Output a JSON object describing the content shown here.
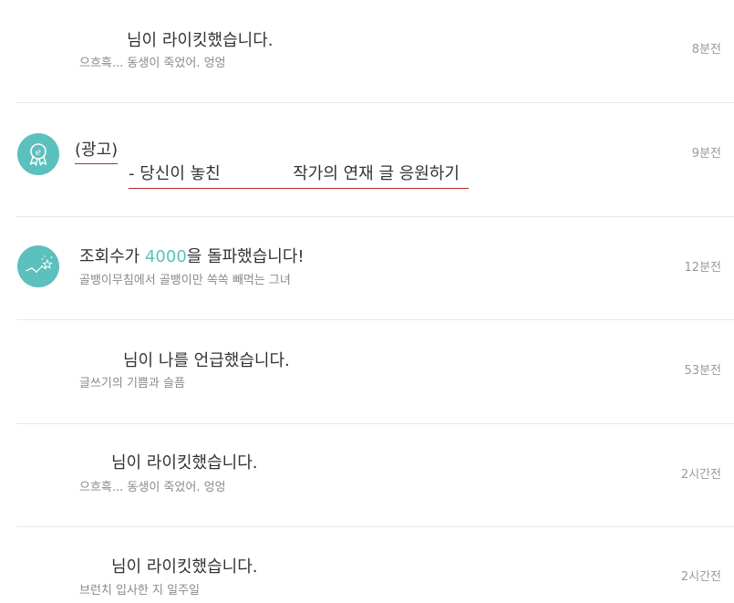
{
  "notifications": [
    {
      "title": "님이 라이킷했습니다.",
      "subtitle": "으흐흑... 동생이 죽었어. 엉엉",
      "time": "8분전"
    },
    {
      "ad_tag": "(광고)",
      "ad_prefix": "- 당신이 놓친",
      "ad_text": "작가의 연재 글 응원하기",
      "time": "9분전"
    },
    {
      "title_prefix": "조회수가 ",
      "title_number": "4000",
      "title_suffix": "을 돌파했습니다!",
      "subtitle": "골뱅이무침에서 골뱅이만 쏙쏙 빼먹는 그녀",
      "time": "12분전"
    },
    {
      "title": "님이 나를 언급했습니다.",
      "subtitle": "글쓰기의 기쁨과 슬픔",
      "time": "53분전"
    },
    {
      "title": "님이 라이킷했습니다.",
      "subtitle": "으흐흑... 동생이 죽었어. 엉엉",
      "time": "2시간전"
    },
    {
      "title": "님이 라이킷했습니다.",
      "subtitle": "브런치 입사한 지 일주일",
      "time": "2시간전"
    }
  ],
  "colors": {
    "accent": "#5bc0be",
    "ad_underline": "#b82a2a",
    "divider": "#e9e9e9"
  },
  "icons": {
    "ad_avatar": "e-badge-icon",
    "views_avatar": "star-chart-icon"
  }
}
